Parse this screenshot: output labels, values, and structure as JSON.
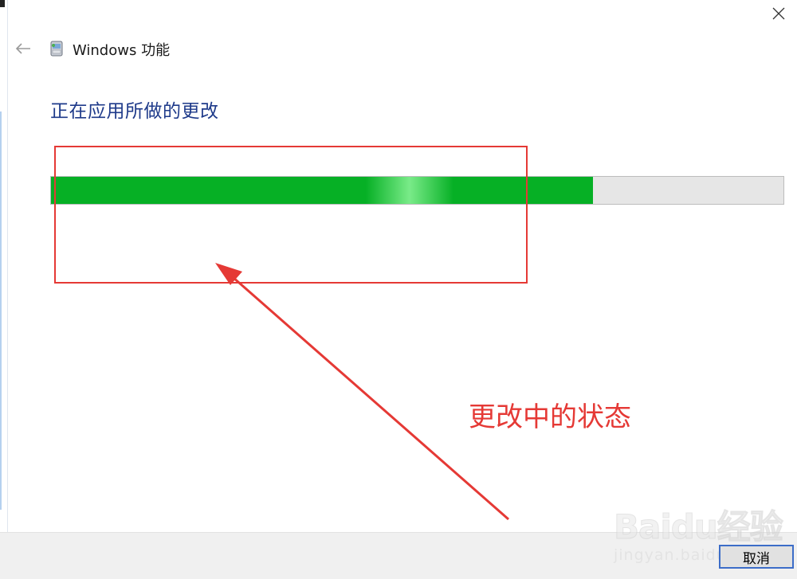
{
  "window": {
    "title": "Windows 功能",
    "close_label": "×"
  },
  "main": {
    "heading": "正在应用所做的更改",
    "progress_value_percent": 74
  },
  "annotation": {
    "caption": "更改中的状态",
    "color": "#e53935"
  },
  "footer": {
    "cancel_label": "取消"
  },
  "watermark": {
    "logo_text": "Baidu经验",
    "url": "jingyan.baidu.com"
  },
  "colors": {
    "heading": "#1e3a8a",
    "progress_fill": "#06b025",
    "progress_track": "#e6e6e6",
    "button_focus_border": "#3c6dc8"
  }
}
